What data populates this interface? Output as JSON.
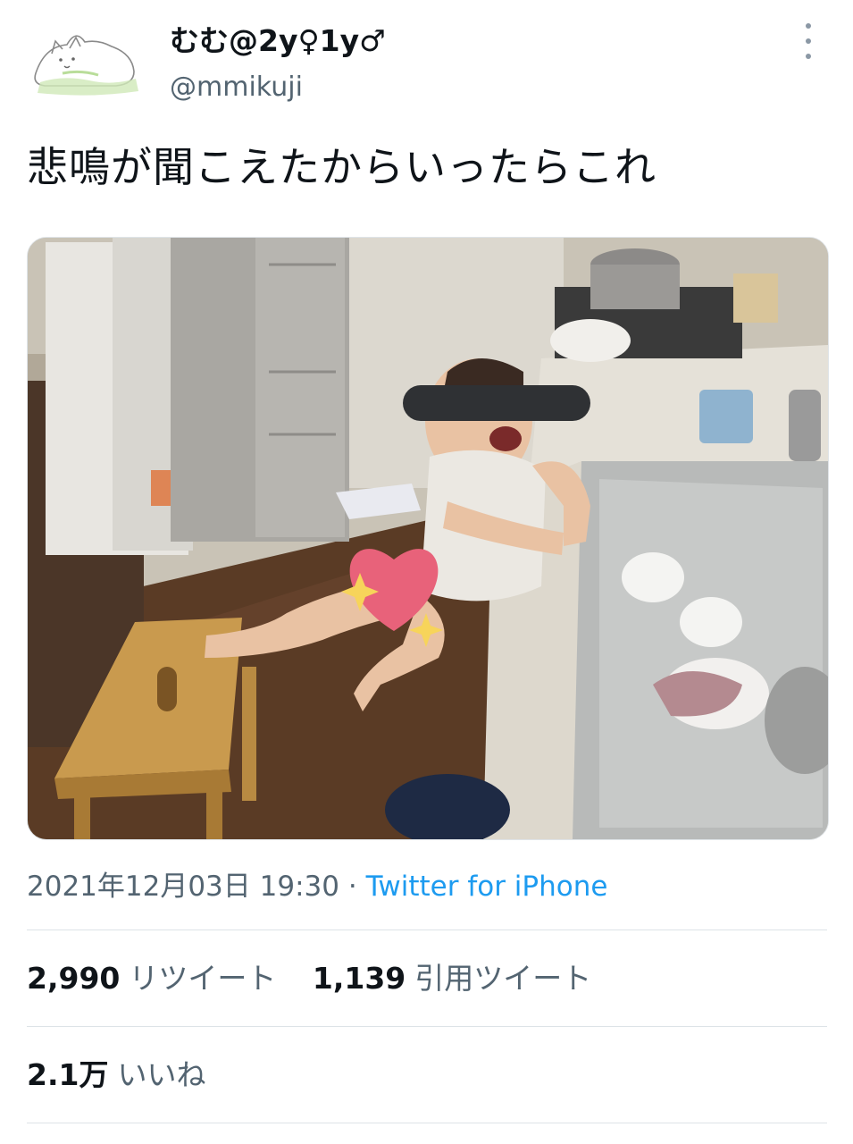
{
  "author": {
    "display_name": "むむ@2y♀1y♂",
    "handle": "@mmikuji"
  },
  "tweet": {
    "text": "悲鳴が聞こえたからいったらこれ"
  },
  "meta": {
    "timestamp": "2021年12月03日 19:30",
    "separator": "·",
    "source": "Twitter for iPhone"
  },
  "stats": {
    "retweets_count": "2,990",
    "retweets_label": "リツイート",
    "quotes_count": "1,139",
    "quotes_label": "引用ツイート",
    "likes_count": "2.1万",
    "likes_label": "いいね"
  },
  "colors": {
    "link": "#1d9bf0",
    "secondary_text": "#536471",
    "primary_text": "#0f1419",
    "divider": "#dde3e7"
  },
  "icons": {
    "more": "more-vertical-icon",
    "avatar": "cat-avatar-illustration"
  }
}
